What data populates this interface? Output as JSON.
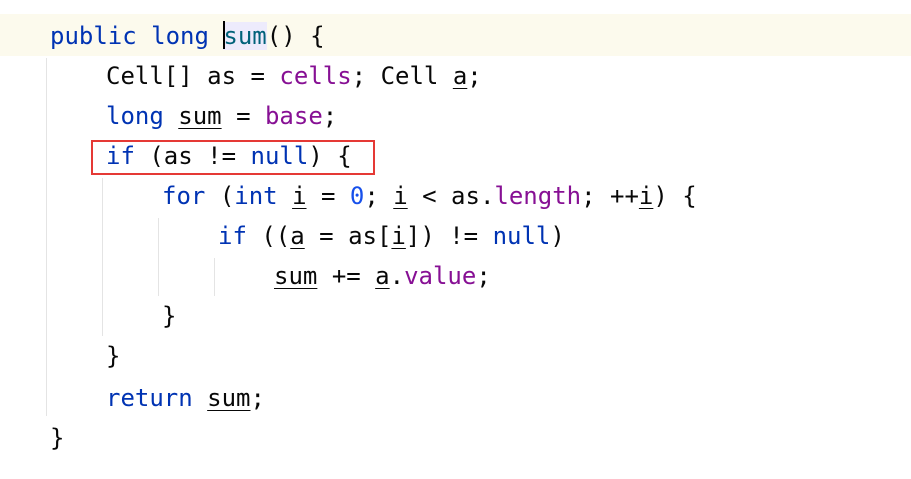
{
  "colors": {
    "keyword": "#0033b3",
    "number": "#1750eb",
    "field": "#871094",
    "method": "#00627a",
    "text": "#080808",
    "current_line": "#fcfaed",
    "highlight_border": "#e53935"
  },
  "code": {
    "line1": {
      "kw_public": "public",
      "kw_long": "long",
      "method_name": "sum",
      "rest": "() {"
    },
    "line2": {
      "type": "Cell[]",
      "var_as": "as",
      "eq": "=",
      "field_cells": "cells",
      "semi": ";",
      "type_cell": "Cell",
      "var_a": "a",
      "end": ";"
    },
    "line3": {
      "kw_long": "long",
      "var_sum": "sum",
      "eq": "=",
      "field_base": "base",
      "end": ";"
    },
    "line4": {
      "kw_if": "if",
      "cond": "(as !=",
      "kw_null": "null",
      "end": ") {"
    },
    "line5": {
      "kw_for": "for",
      "open": "(",
      "kw_int": "int",
      "var_i": "i",
      "eq": "=",
      "zero": "0",
      "semi": ";",
      "var_i2": "i",
      "lt": "< as.",
      "field_length": "length",
      "semi2": "; ++",
      "var_i3": "i",
      "end": ") {"
    },
    "line6": {
      "kw_if": "if",
      "open": "((",
      "var_a": "a",
      "mid": "= as[",
      "var_i": "i",
      "close": "]) !=",
      "kw_null": "null",
      "end": ")"
    },
    "line7": {
      "var_sum": "sum",
      "op": "+=",
      "var_a": "a",
      "dot": ".",
      "field_value": "value",
      "end": ";"
    },
    "line8": {
      "brace": "}"
    },
    "line9": {
      "brace": "}"
    },
    "line10": {
      "kw_return": "return",
      "var_sum": "sum",
      "end": ";"
    },
    "line11": {
      "brace": "}"
    }
  }
}
